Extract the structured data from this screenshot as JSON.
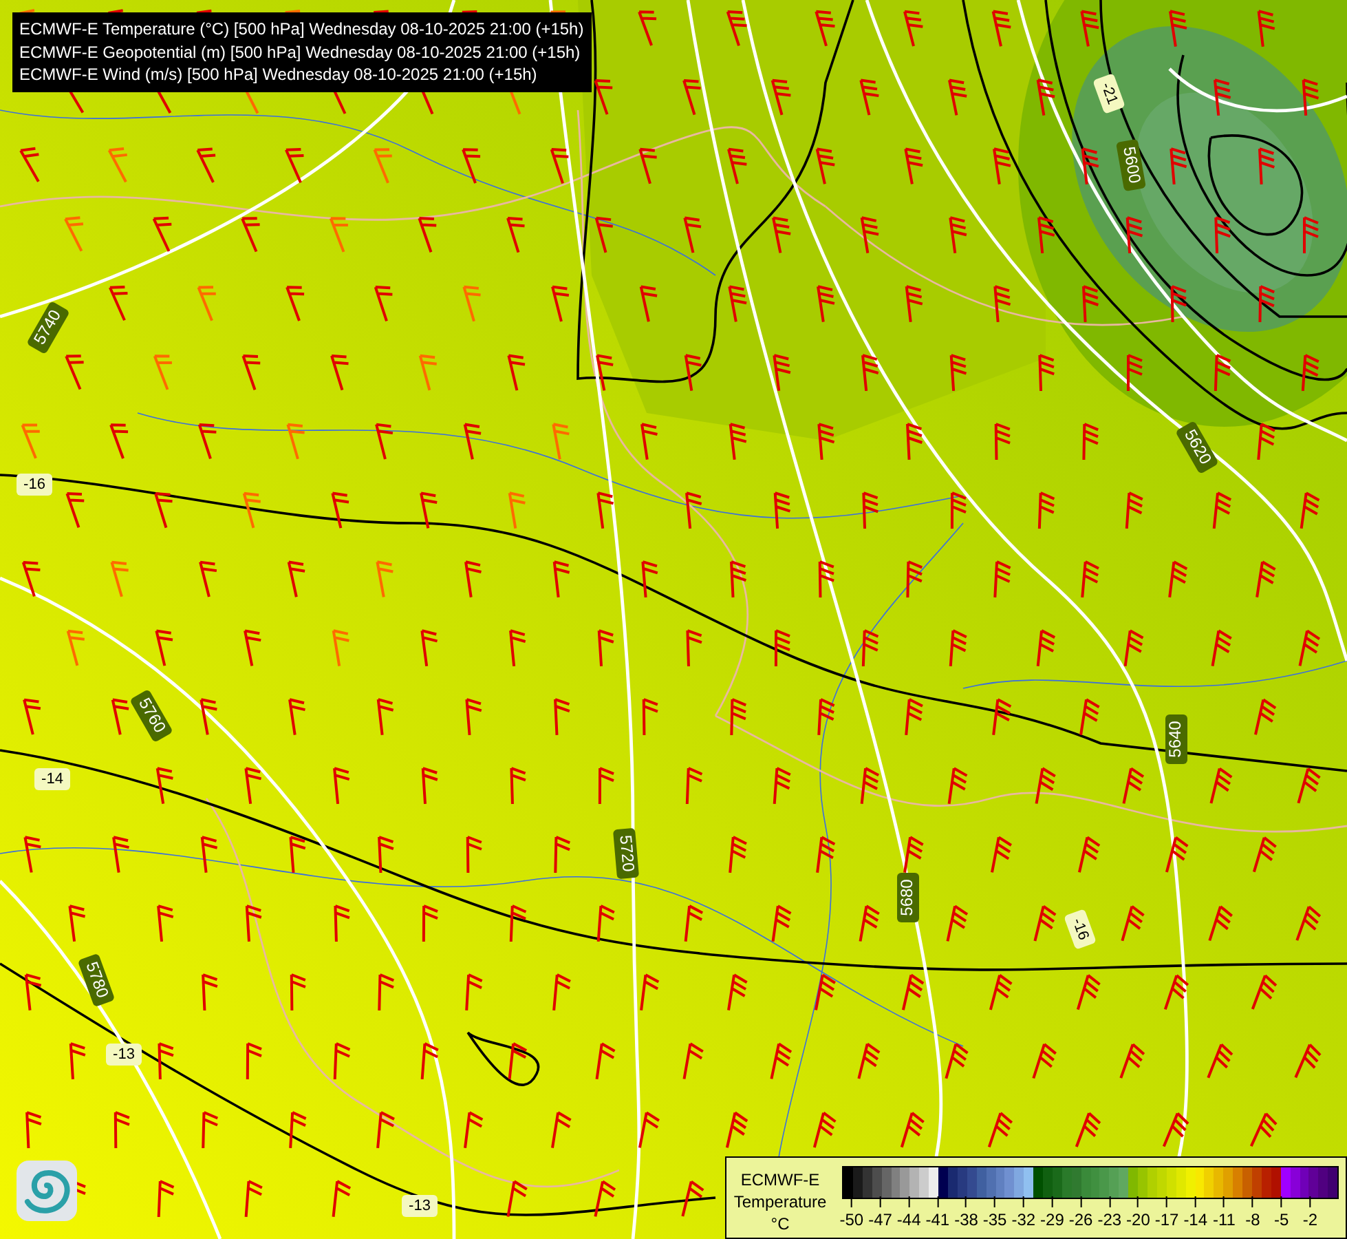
{
  "title_lines": [
    "ECMWF-E Temperature (°C) [500 hPa] Wednesday 08-10-2025 21:00 (+15h)",
    "ECMWF-E Geopotential (m) [500 hPa] Wednesday 08-10-2025 21:00 (+15h)",
    "ECMWF-E Wind (m/s) [500 hPa] Wednesday 08-10-2025 21:00 (+15h)"
  ],
  "map": {
    "geopotential_labels": [
      "5740",
      "5760",
      "5780",
      "5720",
      "5680",
      "5640",
      "5620",
      "5600"
    ],
    "temperature_labels": [
      "-16",
      "-14",
      "-13",
      "-13",
      "-16",
      "-21"
    ]
  },
  "legend": {
    "model": "ECMWF-E",
    "variable": "Temperature",
    "unit": "°C",
    "swatches": [
      {
        "color": "#000000"
      },
      {
        "color": "#1a1a1a"
      },
      {
        "color": "#333333"
      },
      {
        "color": "#4d4d4d"
      },
      {
        "color": "#666666"
      },
      {
        "color": "#808080"
      },
      {
        "color": "#999999"
      },
      {
        "color": "#b3b3b3"
      },
      {
        "color": "#cccccc"
      },
      {
        "color": "#ececec"
      },
      {
        "color": "#000050"
      },
      {
        "color": "#1a2a70"
      },
      {
        "color": "#283a80"
      },
      {
        "color": "#344a90"
      },
      {
        "color": "#4060a0"
      },
      {
        "color": "#5070b0"
      },
      {
        "color": "#6080c0"
      },
      {
        "color": "#7090d0"
      },
      {
        "color": "#80a8e0"
      },
      {
        "color": "#90c0f0"
      },
      {
        "color": "#005000"
      },
      {
        "color": "#106010"
      },
      {
        "color": "#1a6a1a"
      },
      {
        "color": "#2a7a2a"
      },
      {
        "color": "#307a30"
      },
      {
        "color": "#3a8a3a"
      },
      {
        "color": "#409040"
      },
      {
        "color": "#4a984a"
      },
      {
        "color": "#55a055"
      },
      {
        "color": "#60a860"
      },
      {
        "color": "#80b800"
      },
      {
        "color": "#98c400"
      },
      {
        "color": "#b0d000"
      },
      {
        "color": "#c0d800"
      },
      {
        "color": "#d0e000"
      },
      {
        "color": "#e0e800"
      },
      {
        "color": "#f0f000"
      },
      {
        "color": "#f8e800"
      },
      {
        "color": "#f0d000"
      },
      {
        "color": "#e8b800"
      },
      {
        "color": "#e0a000"
      },
      {
        "color": "#d88000"
      },
      {
        "color": "#c86000"
      },
      {
        "color": "#c04000"
      },
      {
        "color": "#b82000"
      },
      {
        "color": "#b01000"
      },
      {
        "color": "#a000ff"
      },
      {
        "color": "#8800d8"
      },
      {
        "color": "#7000b8"
      },
      {
        "color": "#600098"
      },
      {
        "color": "#500080"
      },
      {
        "color": "#400070"
      }
    ],
    "ticks": [
      "-50",
      "-47",
      "-44",
      "-41",
      "-38",
      "-35",
      "-32",
      "-29",
      "-26",
      "-23",
      "-20",
      "-17",
      "-14",
      "-11",
      "-8",
      "-5",
      "-2"
    ]
  }
}
